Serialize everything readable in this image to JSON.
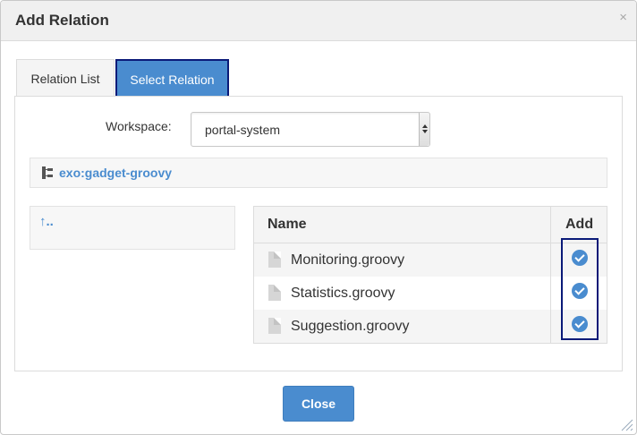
{
  "dialog": {
    "title": "Add Relation",
    "close_glyph": "×"
  },
  "tabs": [
    {
      "label": "Relation List"
    },
    {
      "label": "Select Relation"
    }
  ],
  "workspace": {
    "label": "Workspace:",
    "selected": "portal-system"
  },
  "path": {
    "text": "exo:gadget-groovy",
    "icon": "tree-node-icon"
  },
  "tree": {
    "up_label": "↑.."
  },
  "table": {
    "headers": {
      "name": "Name",
      "add": "Add"
    },
    "rows": [
      {
        "name": "Monitoring.groovy"
      },
      {
        "name": "Statistics.groovy"
      },
      {
        "name": "Suggestion.groovy"
      }
    ]
  },
  "footer": {
    "close_label": "Close"
  },
  "colors": {
    "accent": "#4a8ccf",
    "focus_outline": "#0a1a78"
  }
}
